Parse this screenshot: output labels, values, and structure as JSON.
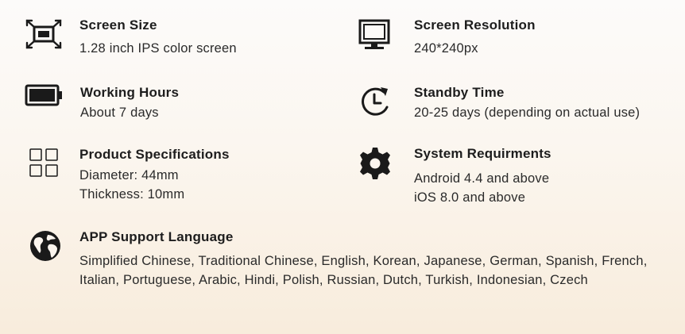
{
  "specs": {
    "screen_size": {
      "icon": "screen-size-icon",
      "title": "Screen Size",
      "lines": [
        "1.28 inch IPS color screen"
      ]
    },
    "screen_resolution": {
      "icon": "monitor-icon",
      "title": "Screen Resolution",
      "lines": [
        "240*240px"
      ]
    },
    "working_hours": {
      "icon": "battery-icon",
      "title": "Working Hours",
      "lines": [
        "About 7 days"
      ]
    },
    "standby_time": {
      "icon": "clock-icon",
      "title": "Standby Time",
      "lines": [
        "20-25 days (depending on actual use)"
      ]
    },
    "product_specifications": {
      "icon": "grid-icon",
      "title": "Product Specifications",
      "lines": [
        "Diameter: 44mm",
        "Thickness: 10mm"
      ]
    },
    "system_requirements": {
      "icon": "gear-icon",
      "title": "System Requirments",
      "lines": [
        "Android 4.4 and above",
        "iOS 8.0 and above"
      ]
    },
    "app_language": {
      "icon": "globe-icon",
      "title": "APP Support Language",
      "text": "Simplified Chinese, Traditional Chinese, English, Korean, Japanese, German, Spanish, French, Italian, Portuguese, Arabic, Hindi, Polish, Russian, Dutch, Turkish, Indonesian, Czech"
    }
  },
  "colors": {
    "text": "#222222",
    "icon": "#1a1a1a",
    "background_top": "#fcfbfa",
    "background_bottom": "#f8ecdc"
  }
}
